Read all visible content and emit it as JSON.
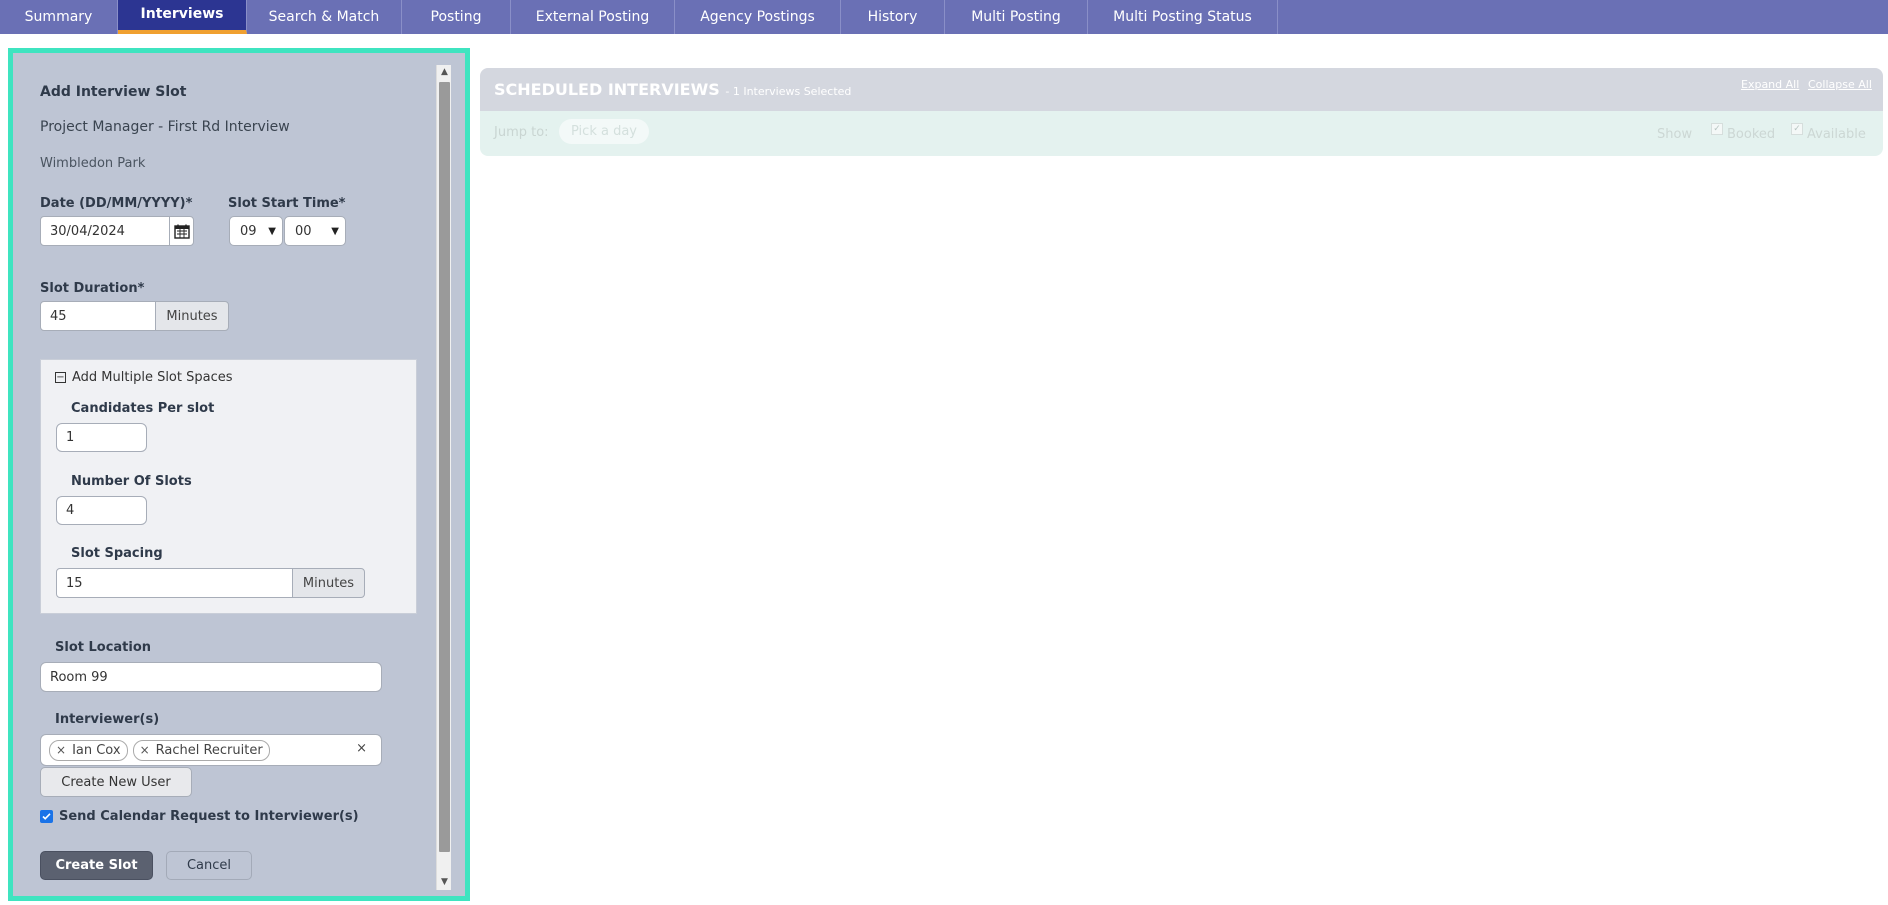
{
  "tabs": [
    {
      "label": "Summary",
      "active": false
    },
    {
      "label": "Interviews",
      "active": true
    },
    {
      "label": "Search & Match",
      "active": false
    },
    {
      "label": "Posting",
      "active": false
    },
    {
      "label": "External Posting",
      "active": false
    },
    {
      "label": "Agency Postings",
      "active": false
    },
    {
      "label": "History",
      "active": false
    },
    {
      "label": "Multi Posting",
      "active": false
    },
    {
      "label": "Multi Posting Status",
      "active": false
    }
  ],
  "form": {
    "title": "Add Interview Slot",
    "project": "Project Manager - First Rd Interview",
    "location_name": "Wimbledon Park",
    "date_label": "Date (DD/MM/YYYY)*",
    "date_value": "30/04/2024",
    "start_time_label": "Slot Start Time*",
    "hour_value": "09",
    "minute_value": "00",
    "duration_label": "Slot Duration*",
    "duration_value": "45",
    "duration_unit": "Minutes",
    "multi": {
      "toggle_label": "Add Multiple Slot Spaces",
      "candidates_label": "Candidates Per slot",
      "candidates_value": "1",
      "number_label": "Number Of Slots",
      "number_value": "4",
      "spacing_label": "Slot Spacing",
      "spacing_value": "15",
      "spacing_unit": "Minutes"
    },
    "slot_location_label": "Slot Location",
    "slot_location_value": "Room 99",
    "interviewers_label": "Interviewer(s)",
    "interviewers": [
      "Ian Cox",
      "Rachel Recruiter"
    ],
    "clear_all": "×",
    "create_user_label": "Create New User",
    "calendar_request_label": "Send Calendar Request to Interviewer(s)",
    "calendar_request_checked": true,
    "create_slot_label": "Create Slot",
    "cancel_label": "Cancel"
  },
  "scheduled": {
    "title": "SCHEDULED INTERVIEWS",
    "subtitle": "- 1 Interviews Selected",
    "expand_all": "Expand All",
    "collapse_all": "Collapse All",
    "jump_label": "Jump to:",
    "pick_day": "Pick a day",
    "show_label": "Show",
    "booked_label": "Booked",
    "available_label": "Available"
  },
  "colors": {
    "topbar": "#6a70b5",
    "active_tab": "#2c3592",
    "active_underline": "#f0a030",
    "panel_border": "#3fe4c0",
    "panel_bg": "#bec5d4"
  }
}
